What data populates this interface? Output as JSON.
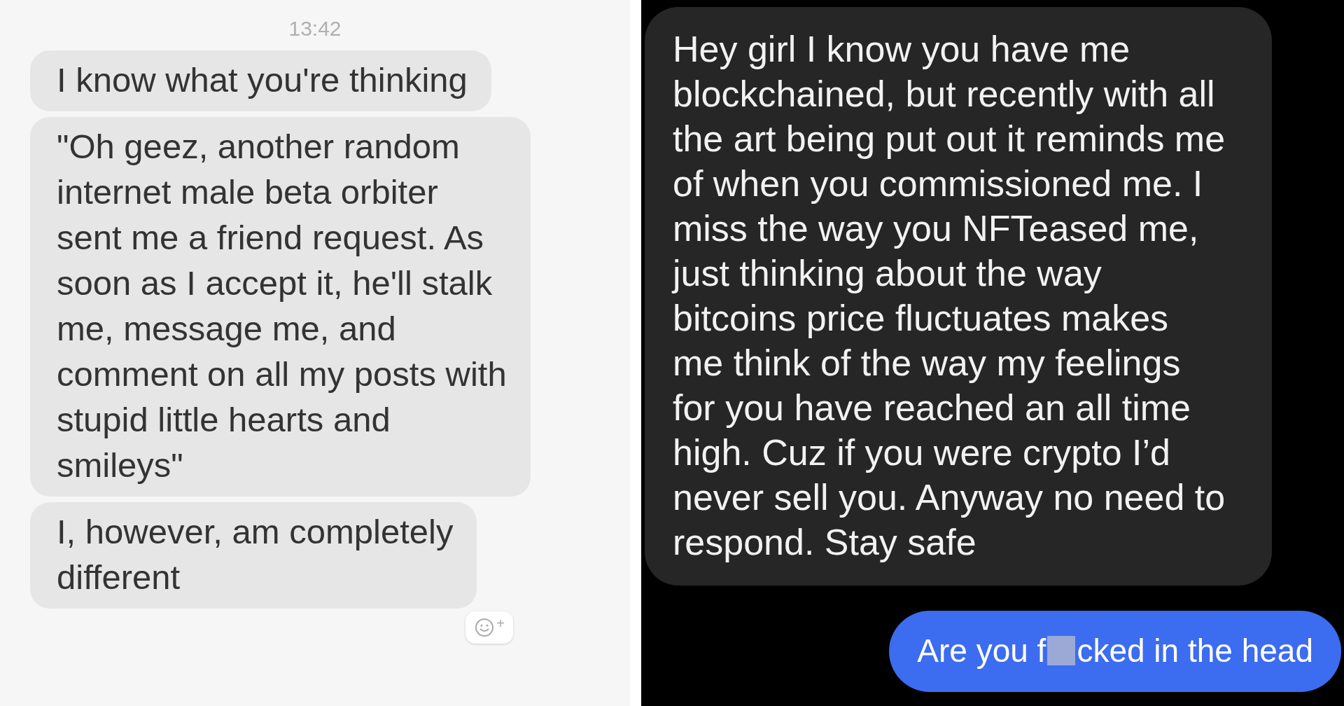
{
  "left_chat": {
    "timestamp": "13:42",
    "messages": [
      {
        "text": "I know what you're thinking"
      },
      {
        "text": "\"Oh geez, another random\ninternet male beta orbiter\nsent me a friend request. As\nsoon as I accept it, he'll stalk\nme, message me, and\ncomment on all my posts with\nstupid little hearts and\nsmileys\""
      },
      {
        "text": "I, however, am completely\ndifferent"
      }
    ],
    "reaction_button": {
      "label": "+"
    }
  },
  "right_chat": {
    "messages": [
      {
        "text": "Hey girl I know you have me\nblockchained, but recently with all\nthe art being put out it reminds me\nof when you commissioned me. I\nmiss the way you NFTeased me,\njust thinking about the way\nbitcoins price fluctuates makes\nme think of the way my feelings\nfor you have reached an all time\nhigh. Cuz if you were crypto I’d\nnever sell you. Anyway no need to\nrespond. Stay safe"
      }
    ],
    "reply": {
      "text_before": "Are you f",
      "censored": true,
      "text_after": "cked in the head"
    }
  }
}
